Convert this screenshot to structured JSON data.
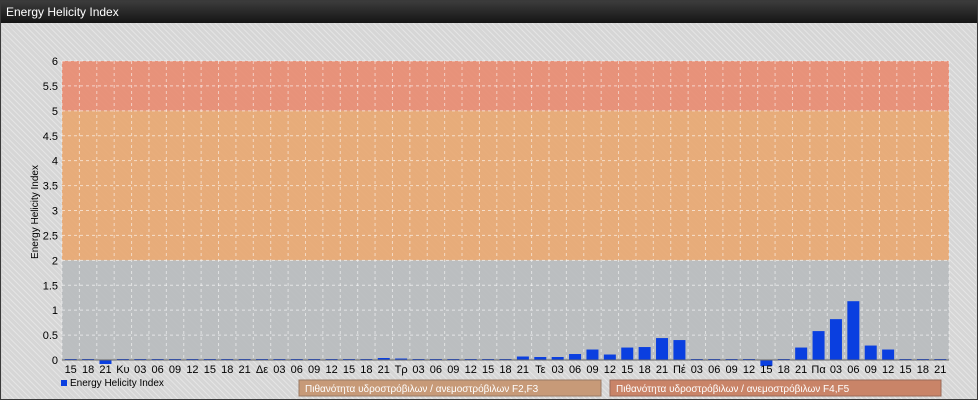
{
  "window": {
    "title": "Energy Helicity Index"
  },
  "chart_data": {
    "type": "bar",
    "title": "",
    "ylabel": "Energy Helicity Index",
    "xlabel": "",
    "ylim": [
      0,
      6
    ],
    "y_ticks": [
      "0",
      "0.5",
      "1",
      "1.5",
      "2",
      "2.5",
      "3",
      "3.5",
      "4",
      "4.5",
      "5",
      "5.5",
      "6"
    ],
    "categories": [
      "15",
      "18",
      "21",
      "Κυ",
      "03",
      "06",
      "09",
      "12",
      "15",
      "18",
      "21",
      "Δε",
      "03",
      "06",
      "09",
      "12",
      "15",
      "18",
      "21",
      "Τρ",
      "03",
      "06",
      "09",
      "12",
      "15",
      "18",
      "21",
      "Τε",
      "03",
      "06",
      "09",
      "12",
      "15",
      "18",
      "21",
      "Πέ",
      "03",
      "06",
      "09",
      "12",
      "15",
      "18",
      "21",
      "Πα",
      "03",
      "06",
      "09",
      "12",
      "15",
      "18",
      "21"
    ],
    "series": [
      {
        "name": "Energy Helicity Index",
        "values": [
          0.02,
          0.02,
          -0.08,
          0.02,
          0.02,
          0.02,
          0.02,
          0.02,
          0.02,
          0.02,
          0.02,
          0.02,
          0.02,
          0.02,
          0.02,
          0.02,
          0.02,
          0.02,
          0.04,
          0.03,
          0.02,
          0.02,
          0.02,
          0.02,
          0.02,
          0.02,
          0.07,
          0.06,
          0.06,
          0.12,
          0.21,
          0.11,
          0.25,
          0.26,
          0.44,
          0.4,
          0.02,
          0.02,
          0.02,
          0.02,
          -0.12,
          0.02,
          0.25,
          0.58,
          0.82,
          1.18,
          0.29,
          0.21,
          0.02,
          0.02,
          0.02
        ],
        "color": "#0a3fe0"
      }
    ],
    "bands": [
      {
        "from": 5,
        "to": 6,
        "color": "#e88c72"
      },
      {
        "from": 2,
        "to": 5,
        "color": "#e8a872"
      },
      {
        "from": 0,
        "to": 2,
        "color": "#b9bcbe"
      }
    ],
    "grid": true,
    "legend": [
      {
        "label": "Energy Helicity Index",
        "color": "#0a3fe0"
      },
      {
        "label": "Πιθανότητα υδροστρόβιλων / ανεμοστρόβιλων F2,F3",
        "color": "#c79a78"
      },
      {
        "label": "Πιθανότητα υδροστρόβιλων / ανεμοστρόβιλων F4,F5",
        "color": "#c98468"
      }
    ]
  }
}
